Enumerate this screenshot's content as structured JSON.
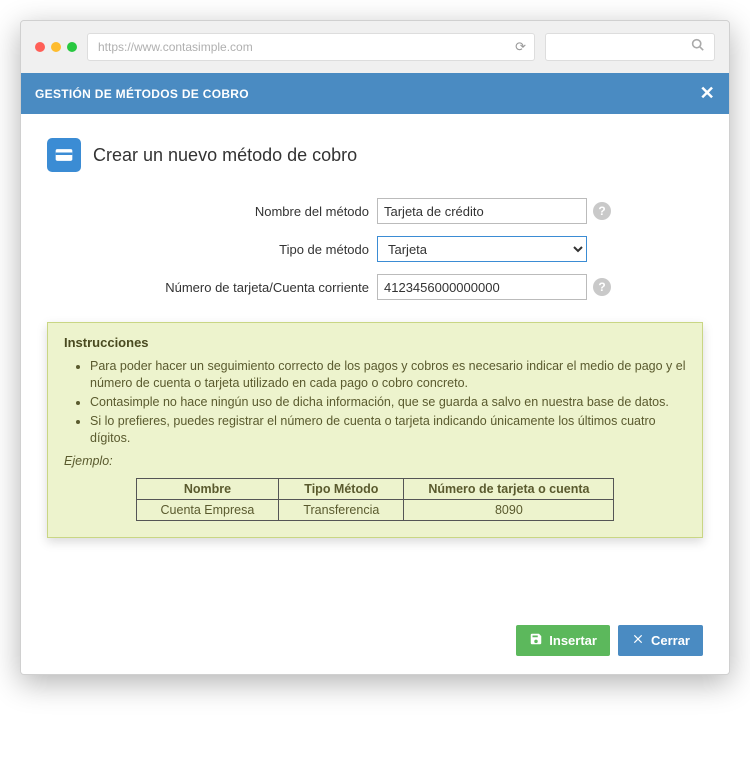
{
  "browser": {
    "url": "https://www.contasimple.com"
  },
  "modal": {
    "title": "GESTIÓN DE MÉTODOS DE COBRO"
  },
  "page": {
    "heading": "Crear un nuevo método de cobro"
  },
  "form": {
    "method_name": {
      "label": "Nombre del método",
      "value": "Tarjeta de crédito"
    },
    "method_type": {
      "label": "Tipo de método",
      "value": "Tarjeta"
    },
    "number": {
      "label": "Número de tarjeta/Cuenta corriente",
      "value": "4123456000000000"
    }
  },
  "instructions": {
    "title": "Instrucciones",
    "items": [
      "Para poder hacer un seguimiento correcto de los pagos y cobros es necesario indicar el medio de pago y el número de cuenta o tarjeta utilizado en cada pago o cobro concreto.",
      "Contasimple no hace ningún uso de dicha información, que se guarda a salvo en nuestra base de datos.",
      "Si lo prefieres, puedes registrar el número de cuenta o tarjeta indicando únicamente los últimos cuatro dígitos."
    ],
    "example_label": "Ejemplo:",
    "example": {
      "headers": [
        "Nombre",
        "Tipo Método",
        "Número de tarjeta o cuenta"
      ],
      "row": [
        "Cuenta Empresa",
        "Transferencia",
        "8090"
      ]
    }
  },
  "buttons": {
    "insert": "Insertar",
    "close": "Cerrar"
  }
}
